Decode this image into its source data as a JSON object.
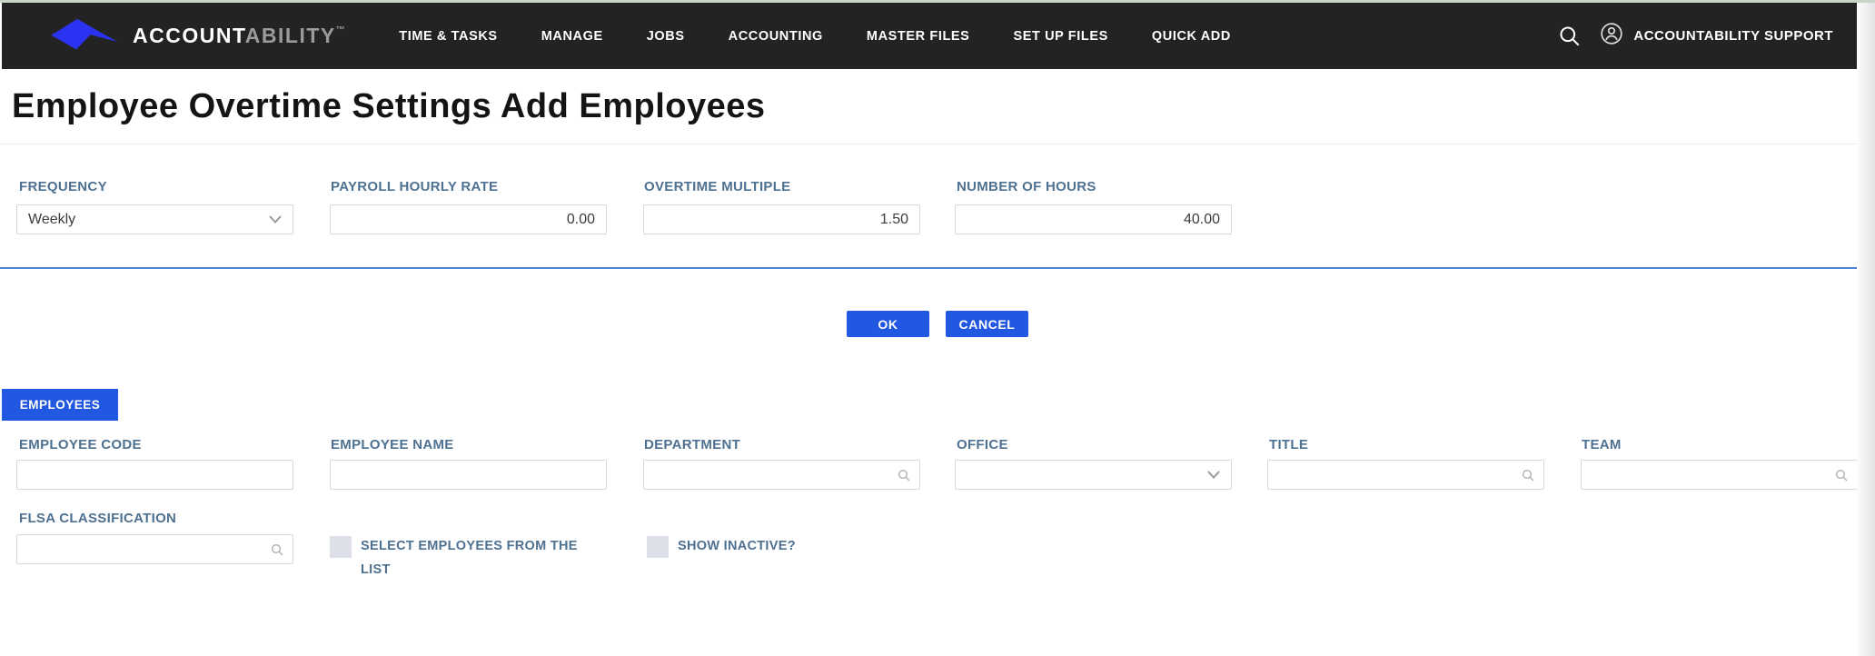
{
  "colors": {
    "nav_background": "#232323",
    "accent_blue": "#2257e1",
    "logo_blue": "#2b33f2",
    "divider_blue": "#4d82d9",
    "label_blue": "#4e7191",
    "frame_strip": "#cbd2c9"
  },
  "nav": {
    "brand": {
      "logo_icon": "diamond-swoosh-logo",
      "name_primary": "ACCOUNT",
      "name_secondary": "ABILITY",
      "trademark": "™"
    },
    "items": [
      {
        "label": "TIME & TASKS"
      },
      {
        "label": "MANAGE"
      },
      {
        "label": "JOBS"
      },
      {
        "label": "ACCOUNTING"
      },
      {
        "label": "MASTER FILES"
      },
      {
        "label": "SET UP FILES"
      },
      {
        "label": "QUICK ADD"
      }
    ],
    "search_icon": "search-icon",
    "user": {
      "avatar_icon": "user-avatar-icon",
      "label": "ACCOUNTABILITY SUPPORT"
    }
  },
  "page": {
    "title": "Employee Overtime Settings Add Employees"
  },
  "overtime_form": {
    "frequency": {
      "label": "FREQUENCY",
      "value": "Weekly",
      "control": "dropdown"
    },
    "payroll_hourly_rate": {
      "label": "PAYROLL HOURLY RATE",
      "value": "0.00"
    },
    "overtime_multiple": {
      "label": "OVERTIME MULTIPLE",
      "value": "1.50"
    },
    "number_of_hours": {
      "label": "NUMBER OF HOURS",
      "value": "40.00"
    },
    "ok_label": "OK",
    "cancel_label": "CANCEL"
  },
  "employees_section": {
    "tab_label": "EMPLOYEES",
    "employee_code": {
      "label": "EMPLOYEE CODE",
      "value": ""
    },
    "employee_name": {
      "label": "EMPLOYEE NAME",
      "value": ""
    },
    "department": {
      "label": "DEPARTMENT",
      "value": "",
      "control": "search"
    },
    "office": {
      "label": "OFFICE",
      "value": "",
      "control": "dropdown"
    },
    "title": {
      "label": "TITLE",
      "value": "",
      "control": "search"
    },
    "team": {
      "label": "TEAM",
      "value": "",
      "control": "search"
    },
    "flsa_classification": {
      "label": "FLSA CLASSIFICATION",
      "value": "",
      "control": "search"
    },
    "select_from_list_checkbox": {
      "label": "SELECT EMPLOYEES FROM THE LIST",
      "checked": false
    },
    "show_inactive_checkbox": {
      "label": "SHOW INACTIVE?",
      "checked": false
    }
  }
}
